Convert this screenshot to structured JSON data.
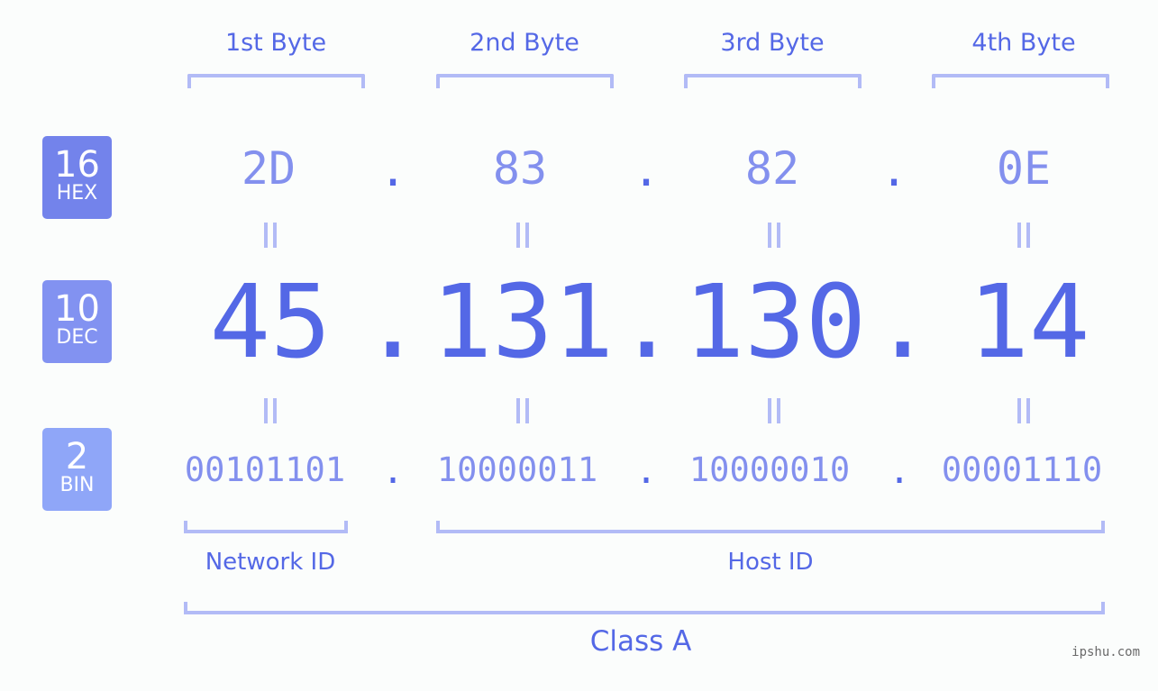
{
  "byte_headers": [
    "1st Byte",
    "2nd Byte",
    "3rd Byte",
    "4th Byte"
  ],
  "bases": [
    {
      "num": "16",
      "label": "HEX",
      "color": "#7383eb"
    },
    {
      "num": "10",
      "label": "DEC",
      "color": "#8292f1"
    },
    {
      "num": "2",
      "label": "BIN",
      "color": "#8fa6f8"
    }
  ],
  "hex": [
    "2D",
    "83",
    "82",
    "0E"
  ],
  "dec": [
    "45",
    "131",
    "130",
    "14"
  ],
  "bin": [
    "00101101",
    "10000011",
    "10000010",
    "00001110"
  ],
  "separator": ".",
  "labels": {
    "network_id": "Network ID",
    "host_id": "Host ID",
    "class": "Class A"
  },
  "watermark": "ipshu.com"
}
